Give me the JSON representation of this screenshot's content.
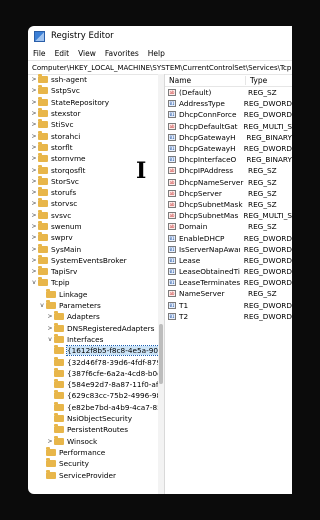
{
  "window": {
    "title": "Registry Editor"
  },
  "menu": [
    "File",
    "Edit",
    "View",
    "Favorites",
    "Help"
  ],
  "address": "Computer\\HKEY_LOCAL_MACHINE\\SYSTEM\\CurrentControlSet\\Services\\Tcpip",
  "tree": [
    {
      "label": "ssh-agent",
      "level": 0,
      "exp": ">"
    },
    {
      "label": "SstpSvc",
      "level": 0,
      "exp": ">"
    },
    {
      "label": "StateRepository",
      "level": 0,
      "exp": ">"
    },
    {
      "label": "stexstor",
      "level": 0,
      "exp": ">"
    },
    {
      "label": "StiSvc",
      "level": 0,
      "exp": ">"
    },
    {
      "label": "storahci",
      "level": 0,
      "exp": ">"
    },
    {
      "label": "storflt",
      "level": 0,
      "exp": ">"
    },
    {
      "label": "stornvme",
      "level": 0,
      "exp": ">"
    },
    {
      "label": "storqosflt",
      "level": 0,
      "exp": ">"
    },
    {
      "label": "StorSvc",
      "level": 0,
      "exp": ">"
    },
    {
      "label": "storufs",
      "level": 0,
      "exp": ">"
    },
    {
      "label": "storvsc",
      "level": 0,
      "exp": ">"
    },
    {
      "label": "svsvc",
      "level": 0,
      "exp": ">"
    },
    {
      "label": "swenum",
      "level": 0,
      "exp": ">"
    },
    {
      "label": "swprv",
      "level": 0,
      "exp": ">"
    },
    {
      "label": "SysMain",
      "level": 0,
      "exp": ">"
    },
    {
      "label": "SystemEventsBroker",
      "level": 0,
      "exp": ">"
    },
    {
      "label": "TapiSrv",
      "level": 0,
      "exp": ">"
    },
    {
      "label": "Tcpip",
      "level": 0,
      "exp": "v"
    },
    {
      "label": "Linkage",
      "level": 1,
      "exp": ""
    },
    {
      "label": "Parameters",
      "level": 1,
      "exp": "v"
    },
    {
      "label": "Adapters",
      "level": 2,
      "exp": ">"
    },
    {
      "label": "DNSRegisteredAdapters",
      "level": 2,
      "exp": ">"
    },
    {
      "label": "Interfaces",
      "level": 2,
      "exp": "v"
    },
    {
      "label": "{1612f8b5-f8c8-4e5a-90e0",
      "level": 3,
      "exp": "",
      "selected": true
    },
    {
      "label": "{32d46f78-39d6-4fdf-8795",
      "level": 3,
      "exp": ""
    },
    {
      "label": "{387f6cfe-6a2a-4cd8-b0c4",
      "level": 3,
      "exp": ""
    },
    {
      "label": "{584e92d7-8a87-11f0-af70",
      "level": 3,
      "exp": ""
    },
    {
      "label": "{629c83cc-75b2-4996-986",
      "level": 3,
      "exp": ""
    },
    {
      "label": "{e82be7bd-a4b9-4ca7-85c",
      "level": 3,
      "exp": ""
    },
    {
      "label": "NsiObjectSecurity",
      "level": 2,
      "exp": ""
    },
    {
      "label": "PersistentRoutes",
      "level": 2,
      "exp": ""
    },
    {
      "label": "Winsock",
      "level": 2,
      "exp": ">"
    },
    {
      "label": "Performance",
      "level": 1,
      "exp": ""
    },
    {
      "label": "Security",
      "level": 1,
      "exp": ""
    },
    {
      "label": "ServiceProvider",
      "level": 1,
      "exp": ""
    }
  ],
  "values": {
    "columns": [
      "Name",
      "Type"
    ],
    "rows": [
      {
        "name": "(Default)",
        "type": "REG_SZ",
        "kind": "str"
      },
      {
        "name": "AddressType",
        "type": "REG_DWORD",
        "kind": "bin"
      },
      {
        "name": "DhcpConnForce",
        "type": "REG_DWORD",
        "kind": "bin"
      },
      {
        "name": "DhcpDefaultGat",
        "type": "REG_MULTI_S",
        "kind": "str"
      },
      {
        "name": "DhcpGatewayH",
        "type": "REG_BINARY",
        "kind": "bin"
      },
      {
        "name": "DhcpGatewayH",
        "type": "REG_DWORD",
        "kind": "bin"
      },
      {
        "name": "DhcpInterfaceO",
        "type": "REG_BINARY",
        "kind": "bin"
      },
      {
        "name": "DhcpIPAddress",
        "type": "REG_SZ",
        "kind": "str"
      },
      {
        "name": "DhcpNameServer",
        "type": "REG_SZ",
        "kind": "str"
      },
      {
        "name": "DhcpServer",
        "type": "REG_SZ",
        "kind": "str"
      },
      {
        "name": "DhcpSubnetMask",
        "type": "REG_SZ",
        "kind": "str"
      },
      {
        "name": "DhcpSubnetMask",
        "type": "REG_MULTI_S",
        "kind": "str"
      },
      {
        "name": "Domain",
        "type": "REG_SZ",
        "kind": "str"
      },
      {
        "name": "EnableDHCP",
        "type": "REG_DWORD",
        "kind": "bin"
      },
      {
        "name": "IsServerNapAware",
        "type": "REG_DWORD",
        "kind": "bin"
      },
      {
        "name": "Lease",
        "type": "REG_DWORD",
        "kind": "bin"
      },
      {
        "name": "LeaseObtainedTi",
        "type": "REG_DWORD",
        "kind": "bin"
      },
      {
        "name": "LeaseTerminates",
        "type": "REG_DWORD",
        "kind": "bin"
      },
      {
        "name": "NameServer",
        "type": "REG_SZ",
        "kind": "str"
      },
      {
        "name": "T1",
        "type": "REG_DWORD",
        "kind": "bin"
      },
      {
        "name": "T2",
        "type": "REG_DWORD",
        "kind": "bin"
      }
    ]
  },
  "icons": {
    "string_value": "ab",
    "binary_value": "01"
  }
}
